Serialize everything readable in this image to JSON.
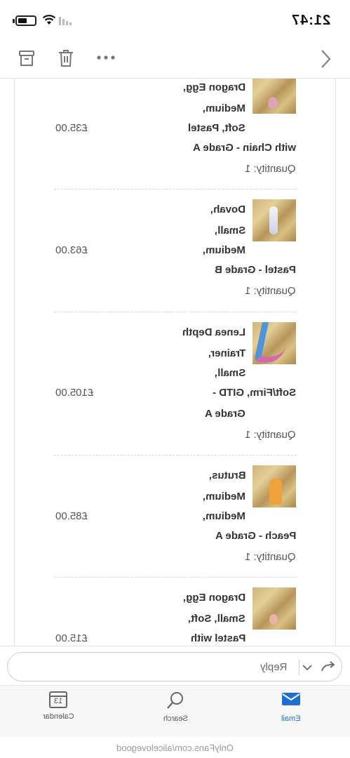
{
  "status_bar": {
    "time": "21:47"
  },
  "toolbar": {
    "archive_icon": "archive-icon",
    "delete_icon": "trash-icon",
    "more_icon": "more-icon",
    "back_icon": "chevron-icon"
  },
  "order_items": [
    {
      "name_lines": [
        "Dragon Egg,",
        "Medium,",
        "Soft, Pastel",
        "with Chain - Grade A"
      ],
      "quantity": "Quantity: 1",
      "price": "£35.00"
    },
    {
      "name_lines": [
        "Dovah,",
        "Small,",
        "Medium,",
        "Pastel - Grade B"
      ],
      "quantity": "Quantity: 1",
      "price": "£63.00"
    },
    {
      "name_lines": [
        "Lenea Depth",
        "Trainer,",
        "Small,",
        "Soft/Firm, GITD -",
        "Grade A"
      ],
      "quantity": "Quantity: 1",
      "price": "£105.00"
    },
    {
      "name_lines": [
        "Brutus,",
        "Medium,",
        "Medium,",
        "Peach - Grade A"
      ],
      "quantity": "Quantity: 1",
      "price": "£85.00"
    },
    {
      "name_lines": [
        "Dragon Egg,",
        "Small, Soft,",
        "Pastel with"
      ],
      "price": "£15.00"
    }
  ],
  "reply": {
    "label": "Reply"
  },
  "tabs": {
    "email": "Email",
    "search": "Search",
    "calendar": "Calendar",
    "calendar_day": "13"
  },
  "watermark": "OnlyFans.com/alicelovegood",
  "colors": {
    "accent": "#1f6fd0"
  }
}
